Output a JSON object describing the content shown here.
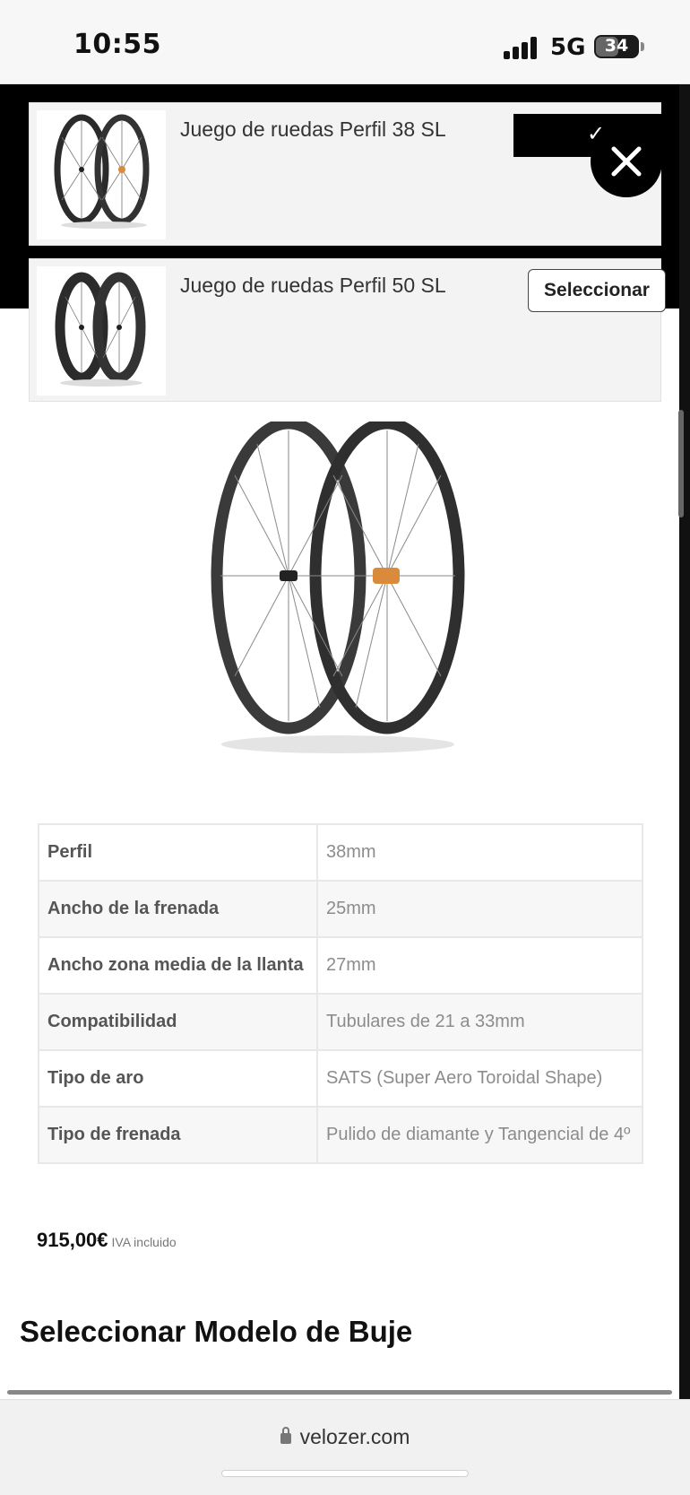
{
  "status_bar": {
    "time": "10:55",
    "network": "5G",
    "battery": "34"
  },
  "options": [
    {
      "title": "Juego de ruedas Perfil 38 SL",
      "state": "selected"
    },
    {
      "title": "Juego de ruedas Perfil 50 SL",
      "button_label": "Seleccionar"
    }
  ],
  "specs": [
    {
      "key": "Perfil",
      "value": "38mm"
    },
    {
      "key": "Ancho de la frenada",
      "value": "25mm"
    },
    {
      "key": "Ancho zona media de la llanta",
      "value": "27mm"
    },
    {
      "key": "Compatibilidad",
      "value": "Tubulares de 21 a 33mm"
    },
    {
      "key": "Tipo de aro",
      "value": "SATS (Super Aero Toroidal Shape)"
    },
    {
      "key": "Tipo de frenada",
      "value": "Pulido de diamante y Tangencial de 4º"
    }
  ],
  "price": {
    "amount": "915,00€",
    "vat_note": "IVA incluido"
  },
  "section": {
    "title": "Seleccionar Modelo de Buje"
  },
  "browser": {
    "url": "velozer.com"
  },
  "icons": {
    "close": "close-icon",
    "check": "check-icon",
    "lock": "lock-icon"
  },
  "colors": {
    "modal_band": "#000000",
    "hub_accent": "#d98a3a"
  }
}
